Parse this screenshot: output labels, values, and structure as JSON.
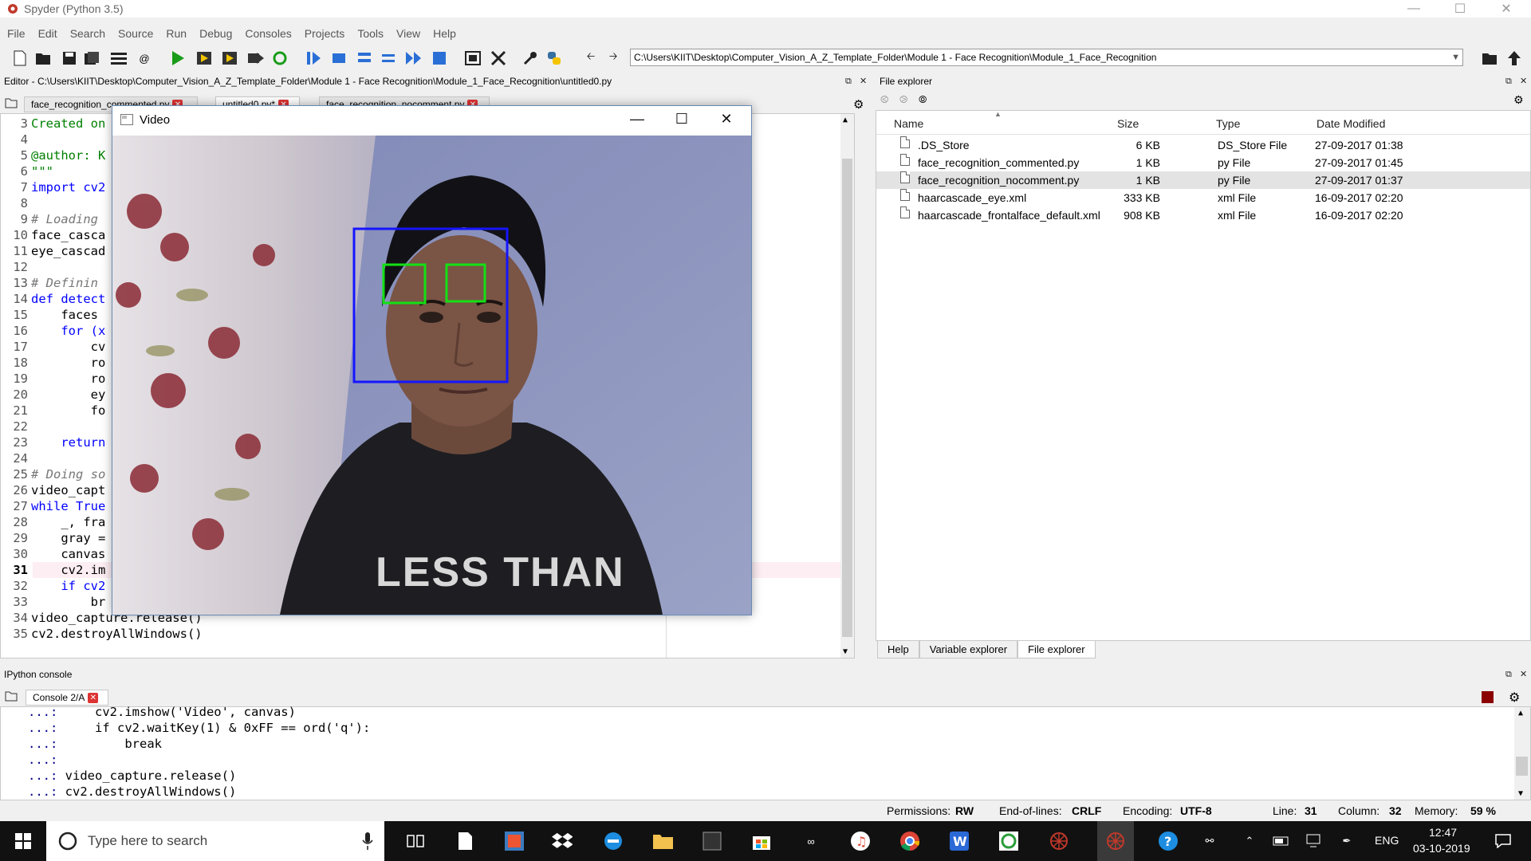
{
  "window": {
    "title": "Spyder (Python 3.5)"
  },
  "menu": [
    "File",
    "Edit",
    "Search",
    "Source",
    "Run",
    "Debug",
    "Consoles",
    "Projects",
    "Tools",
    "View",
    "Help"
  ],
  "toolbar": {
    "path": "C:\\Users\\KIIT\\Desktop\\Computer_Vision_A_Z_Template_Folder\\Module 1 - Face Recognition\\Module_1_Face_Recognition"
  },
  "editor": {
    "header": "Editor - C:\\Users\\KIIT\\Desktop\\Computer_Vision_A_Z_Template_Folder\\Module 1 - Face Recognition\\Module_1_Face_Recognition\\untitled0.py",
    "tabs": [
      {
        "label": "face_recognition_commented.py"
      },
      {
        "label": "untitled0.py*"
      },
      {
        "label": "face_recognition_nocomment.py"
      }
    ],
    "lines": [
      {
        "n": "3",
        "code": "Created on"
      },
      {
        "n": "4",
        "code": ""
      },
      {
        "n": "5",
        "code": "@author: K"
      },
      {
        "n": "6",
        "code": "\"\"\""
      },
      {
        "n": "7",
        "code": "import cv2"
      },
      {
        "n": "8",
        "code": ""
      },
      {
        "n": "9",
        "code": "# Loading"
      },
      {
        "n": "10",
        "code": "face_casca"
      },
      {
        "n": "11",
        "code": "eye_cascad"
      },
      {
        "n": "12",
        "code": ""
      },
      {
        "n": "13",
        "code": "# Definin"
      },
      {
        "n": "14",
        "code": "def detect"
      },
      {
        "n": "15",
        "code": "    faces"
      },
      {
        "n": "16",
        "code": "    for (x"
      },
      {
        "n": "17",
        "code": "        cv"
      },
      {
        "n": "18",
        "code": "        ro"
      },
      {
        "n": "19",
        "code": "        ro"
      },
      {
        "n": "20",
        "code": "        ey"
      },
      {
        "n": "21",
        "code": "        fo"
      },
      {
        "n": "22",
        "code": ""
      },
      {
        "n": "23",
        "code": "    return"
      },
      {
        "n": "24",
        "code": ""
      },
      {
        "n": "25",
        "code": "# Doing so"
      },
      {
        "n": "26",
        "code": "video_capt"
      },
      {
        "n": "27",
        "code": "while True"
      },
      {
        "n": "28",
        "code": "    _, fra"
      },
      {
        "n": "29",
        "code": "    gray ="
      },
      {
        "n": "30",
        "code": "    canvas"
      },
      {
        "n": "31",
        "code": "    cv2.im"
      },
      {
        "n": "32",
        "code": "    if cv2"
      },
      {
        "n": "33",
        "code": "        br"
      },
      {
        "n": "34",
        "code": "video_capture.release()"
      },
      {
        "n": "35",
        "code": "cv2.destroyAllWindows()"
      }
    ]
  },
  "video": {
    "title": "Video",
    "shirt_text": "LESS THAN"
  },
  "file_explorer": {
    "title": "File explorer",
    "columns": [
      "Name",
      "Size",
      "Type",
      "Date Modified"
    ],
    "files": [
      {
        "name": ".DS_Store",
        "size": "6 KB",
        "type": "DS_Store File",
        "date": "27-09-2017 01:38"
      },
      {
        "name": "face_recognition_commented.py",
        "size": "1 KB",
        "type": "py File",
        "date": "27-09-2017 01:45"
      },
      {
        "name": "face_recognition_nocomment.py",
        "size": "1 KB",
        "type": "py File",
        "date": "27-09-2017 01:37"
      },
      {
        "name": "haarcascade_eye.xml",
        "size": "333 KB",
        "type": "xml File",
        "date": "16-09-2017 02:20"
      },
      {
        "name": "haarcascade_frontalface_default.xml",
        "size": "908 KB",
        "type": "xml File",
        "date": "16-09-2017 02:20"
      }
    ],
    "bottom_tabs": [
      "Help",
      "Variable explorer",
      "File explorer"
    ]
  },
  "console": {
    "title": "IPython console",
    "tab": "Console 2/A",
    "lines": [
      {
        "prompt": "   ...:",
        "code": "    cv2.imshow('Video', canvas)"
      },
      {
        "prompt": "   ...:",
        "code": "    if cv2.waitKey(1) & 0xFF == ord('q'):"
      },
      {
        "prompt": "   ...:",
        "code": "        break"
      },
      {
        "prompt": "   ...:",
        "code": ""
      },
      {
        "prompt": "   ...:",
        "code": "video_capture.release()"
      },
      {
        "prompt": "   ...:",
        "code": "cv2.destroyAllWindows()"
      }
    ]
  },
  "status": {
    "permissions_label": "Permissions:",
    "permissions": "RW",
    "eol_label": "End-of-lines:",
    "eol": "CRLF",
    "encoding_label": "Encoding:",
    "encoding": "UTF-8",
    "line_label": "Line:",
    "line": "31",
    "column_label": "Column:",
    "column": "32",
    "memory_label": "Memory:",
    "memory": "59 %"
  },
  "taskbar": {
    "search_placeholder": "Type here to search",
    "lang": "ENG",
    "time": "12:47",
    "date": "03-10-2019"
  }
}
